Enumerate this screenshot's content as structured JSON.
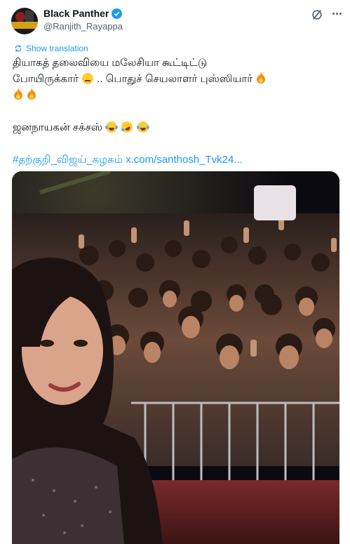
{
  "author": {
    "display_name": "Black Panther",
    "handle": "@Ranjith_Rayappa",
    "verified": true
  },
  "actions": {
    "translate_label": "Show translation",
    "grok_icon": "grok-icon",
    "more_icon": "more-icon"
  },
  "tweet": {
    "line1": "தியாகத் தலைவியை மலேசியா கூட்டிட்டு",
    "line2": "போயிருக்கார் ",
    "line2b": ".. பொதுச் செயலாளர் புஸ்ஸியார்",
    "line4": "ஜனநாயகன் சக்சஸ் ",
    "hashtag": "#தற்குறி_விஜய்_கழகம்",
    "link": "x.com/santhosh_Tvk24..."
  },
  "colors": {
    "accent": "#1d9bf0",
    "text": "#0f1419",
    "secondary": "#536471"
  },
  "media": {
    "type": "photo",
    "icon": "image-icon"
  }
}
